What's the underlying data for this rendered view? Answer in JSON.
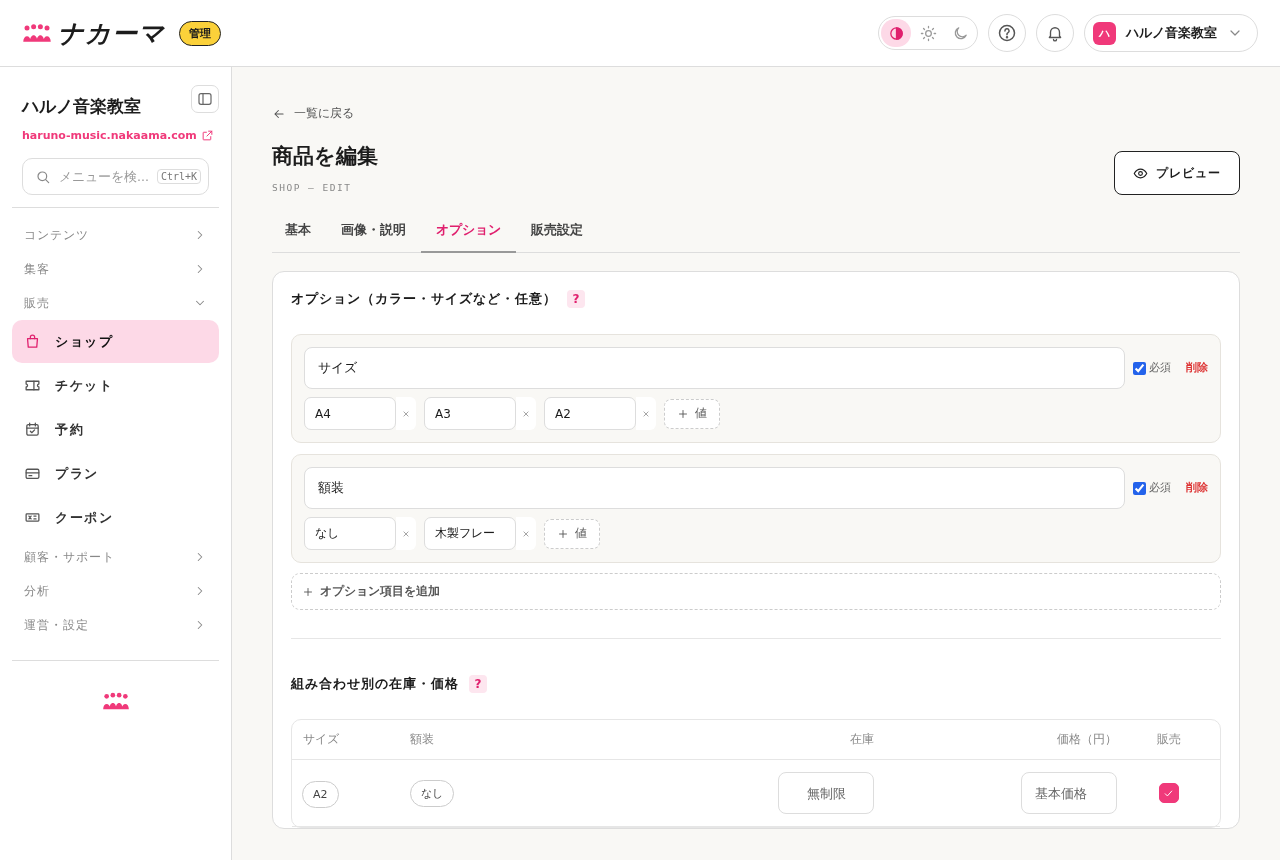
{
  "header": {
    "logo_text": "ナカーマ",
    "badge": "管理",
    "theme_modes": [
      {
        "kind": "auto",
        "selected": true
      },
      {
        "kind": "light",
        "selected": false
      },
      {
        "kind": "dark",
        "selected": false
      }
    ],
    "account": {
      "avatar": "ハ",
      "name": "ハルノ音楽教室"
    }
  },
  "sidebar": {
    "title": "ハルノ音楽教室",
    "url": "haruno-music.nakaama.com",
    "search": {
      "placeholder": "メニューを検...",
      "shortcut": "Ctrl+K"
    },
    "items": [
      {
        "kind": "group",
        "label": "コンテンツ",
        "expanded": false
      },
      {
        "kind": "group",
        "label": "集客",
        "expanded": false
      },
      {
        "kind": "group",
        "label": "販売",
        "expanded": true
      },
      {
        "kind": "bag",
        "label": "ショップ",
        "selected": true
      },
      {
        "kind": "ticket",
        "label": "チケット",
        "selected": false
      },
      {
        "kind": "calendar",
        "label": "予約",
        "selected": false
      },
      {
        "kind": "card",
        "label": "プラン",
        "selected": false
      },
      {
        "kind": "coupon",
        "label": "クーポン",
        "selected": false
      },
      {
        "kind": "group",
        "label": "顧客・サポート",
        "expanded": false
      },
      {
        "kind": "group",
        "label": "分析",
        "expanded": false
      },
      {
        "kind": "group",
        "label": "運営・設定",
        "expanded": false
      }
    ]
  },
  "page": {
    "back": "一覧に戻る",
    "title": "商品を編集",
    "subtitle": "SHOP — EDIT",
    "preview": "プレビュー",
    "tabs": [
      {
        "label": "基本",
        "selected": false
      },
      {
        "label": "画像・説明",
        "selected": false
      },
      {
        "label": "オプション",
        "selected": true
      },
      {
        "label": "販売設定",
        "selected": false
      }
    ]
  },
  "options": {
    "title": "オプション（カラー・サイズなど・任意）",
    "help": "?",
    "items": [
      {
        "name": "サイズ",
        "required": true,
        "required_label": "必須",
        "delete": "削除",
        "values": [
          "A4",
          "A3",
          "A2"
        ],
        "add_value": "値"
      },
      {
        "name": "額装",
        "required": true,
        "required_label": "必須",
        "delete": "削除",
        "values": [
          "なし",
          "木製フレー"
        ],
        "add_value": "値"
      }
    ],
    "add_option": "オプション項目を追加"
  },
  "variants": {
    "title": "組み合わせ別の在庫・価格",
    "help": "?",
    "columns": [
      "サイズ",
      "額装",
      "在庫",
      "価格（円）",
      "販売"
    ],
    "rows": [
      {
        "size": "A2",
        "frame": "なし",
        "stock_placeholder": "無制限",
        "price_placeholder": "基本価格",
        "on_sale": true
      }
    ]
  }
}
